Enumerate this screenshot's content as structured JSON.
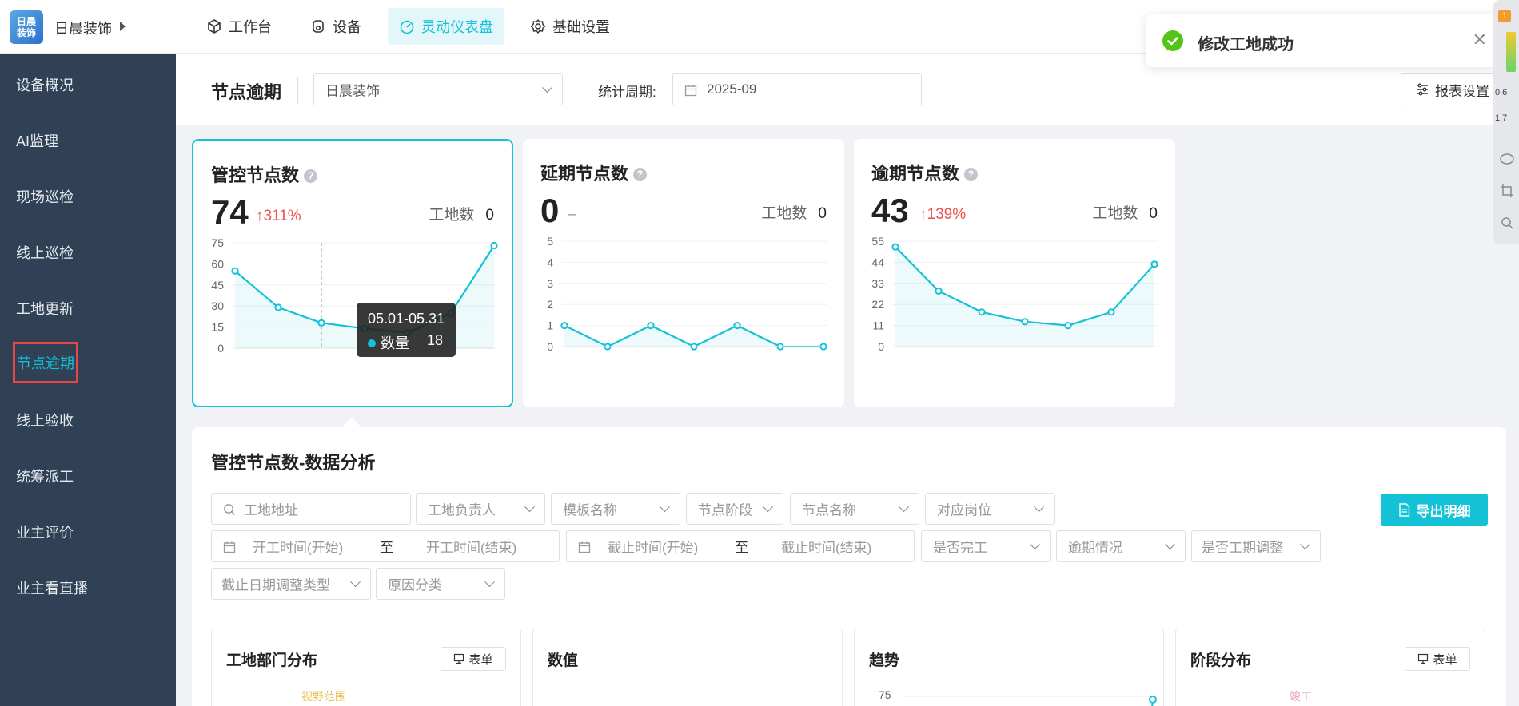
{
  "app": {
    "logo_text": "日晨装饰",
    "company": "日晨装饰"
  },
  "top_nav": [
    {
      "label": "工作台",
      "icon": "cube-icon"
    },
    {
      "label": "设备",
      "icon": "device-icon"
    },
    {
      "label": "灵动仪表盘",
      "icon": "dashboard-icon",
      "active": true
    },
    {
      "label": "基础设置",
      "icon": "gear-icon"
    }
  ],
  "sidebar": {
    "items": [
      {
        "label": "设备概况"
      },
      {
        "label": "AI监理"
      },
      {
        "label": "现场巡检"
      },
      {
        "label": "线上巡检"
      },
      {
        "label": "工地更新"
      },
      {
        "label": "节点逾期",
        "active": true
      },
      {
        "label": "线上验收"
      },
      {
        "label": "统筹派工"
      },
      {
        "label": "业主评价"
      },
      {
        "label": "业主看直播"
      }
    ]
  },
  "header": {
    "title": "节点逾期",
    "company_select": "日晨装饰",
    "period_label": "统计周期:",
    "period_value": "2025-09",
    "report_button": "报表设置"
  },
  "cards": [
    {
      "title": "管控节点数",
      "value": "74",
      "delta": "↑311%",
      "delta_type": "up",
      "site_label": "工地数",
      "site_value": "0",
      "chart_data": {
        "type": "line",
        "ylim": [
          0,
          75
        ],
        "yticks": [
          "75",
          "60",
          "45",
          "30",
          "15",
          "0"
        ],
        "values": [
          55,
          29,
          18,
          14,
          11,
          25,
          73
        ]
      }
    },
    {
      "title": "延期节点数",
      "value": "0",
      "delta": "–",
      "delta_type": "flat",
      "site_label": "工地数",
      "site_value": "0",
      "chart_data": {
        "type": "line",
        "ylim": [
          0,
          5
        ],
        "yticks": [
          "5",
          "4",
          "3",
          "2",
          "1",
          "0"
        ],
        "values": [
          1,
          0,
          1,
          0,
          1,
          0,
          0
        ]
      }
    },
    {
      "title": "逾期节点数",
      "value": "43",
      "delta": "↑139%",
      "delta_type": "up",
      "site_label": "工地数",
      "site_value": "0",
      "chart_data": {
        "type": "line",
        "ylim": [
          0,
          55
        ],
        "yticks": [
          "55",
          "44",
          "33",
          "22",
          "11",
          "0"
        ],
        "values": [
          52,
          29,
          18,
          13,
          11,
          18,
          43
        ]
      }
    }
  ],
  "tooltip": {
    "range": "05.01-05.31",
    "label": "数量",
    "value": "18"
  },
  "analysis": {
    "title": "管控节点数-数据分析",
    "search_placeholder": "工地地址",
    "filters_row1": [
      "工地负责人",
      "模板名称",
      "节点阶段",
      "节点名称",
      "对应岗位"
    ],
    "start_from": "开工时间(开始)",
    "start_to": "开工时间(结束)",
    "deadline_from": "截止时间(开始)",
    "deadline_to": "截止时间(结束)",
    "range_sep": "至",
    "filters_row2": [
      "是否完工",
      "逾期情况",
      "是否工期调整"
    ],
    "filters_row3": [
      "截止日期调整类型",
      "原因分类"
    ],
    "export_button": "导出明细"
  },
  "mini_panels": [
    {
      "title": "工地部门分布",
      "button": "表单",
      "legend": "视野范围"
    },
    {
      "title": "数值"
    },
    {
      "title": "趋势",
      "ytick": "75"
    },
    {
      "title": "阶段分布",
      "button": "表单",
      "legend": "竣工"
    }
  ],
  "toast": {
    "message": "修改工地成功"
  },
  "widget": {
    "badge": "1",
    "speed1": "0.6",
    "speed2": "1.7"
  },
  "colors": {
    "accent": "#13c2d6",
    "sidebar": "#304155",
    "up": "#f0504f",
    "success": "#52c41a"
  }
}
